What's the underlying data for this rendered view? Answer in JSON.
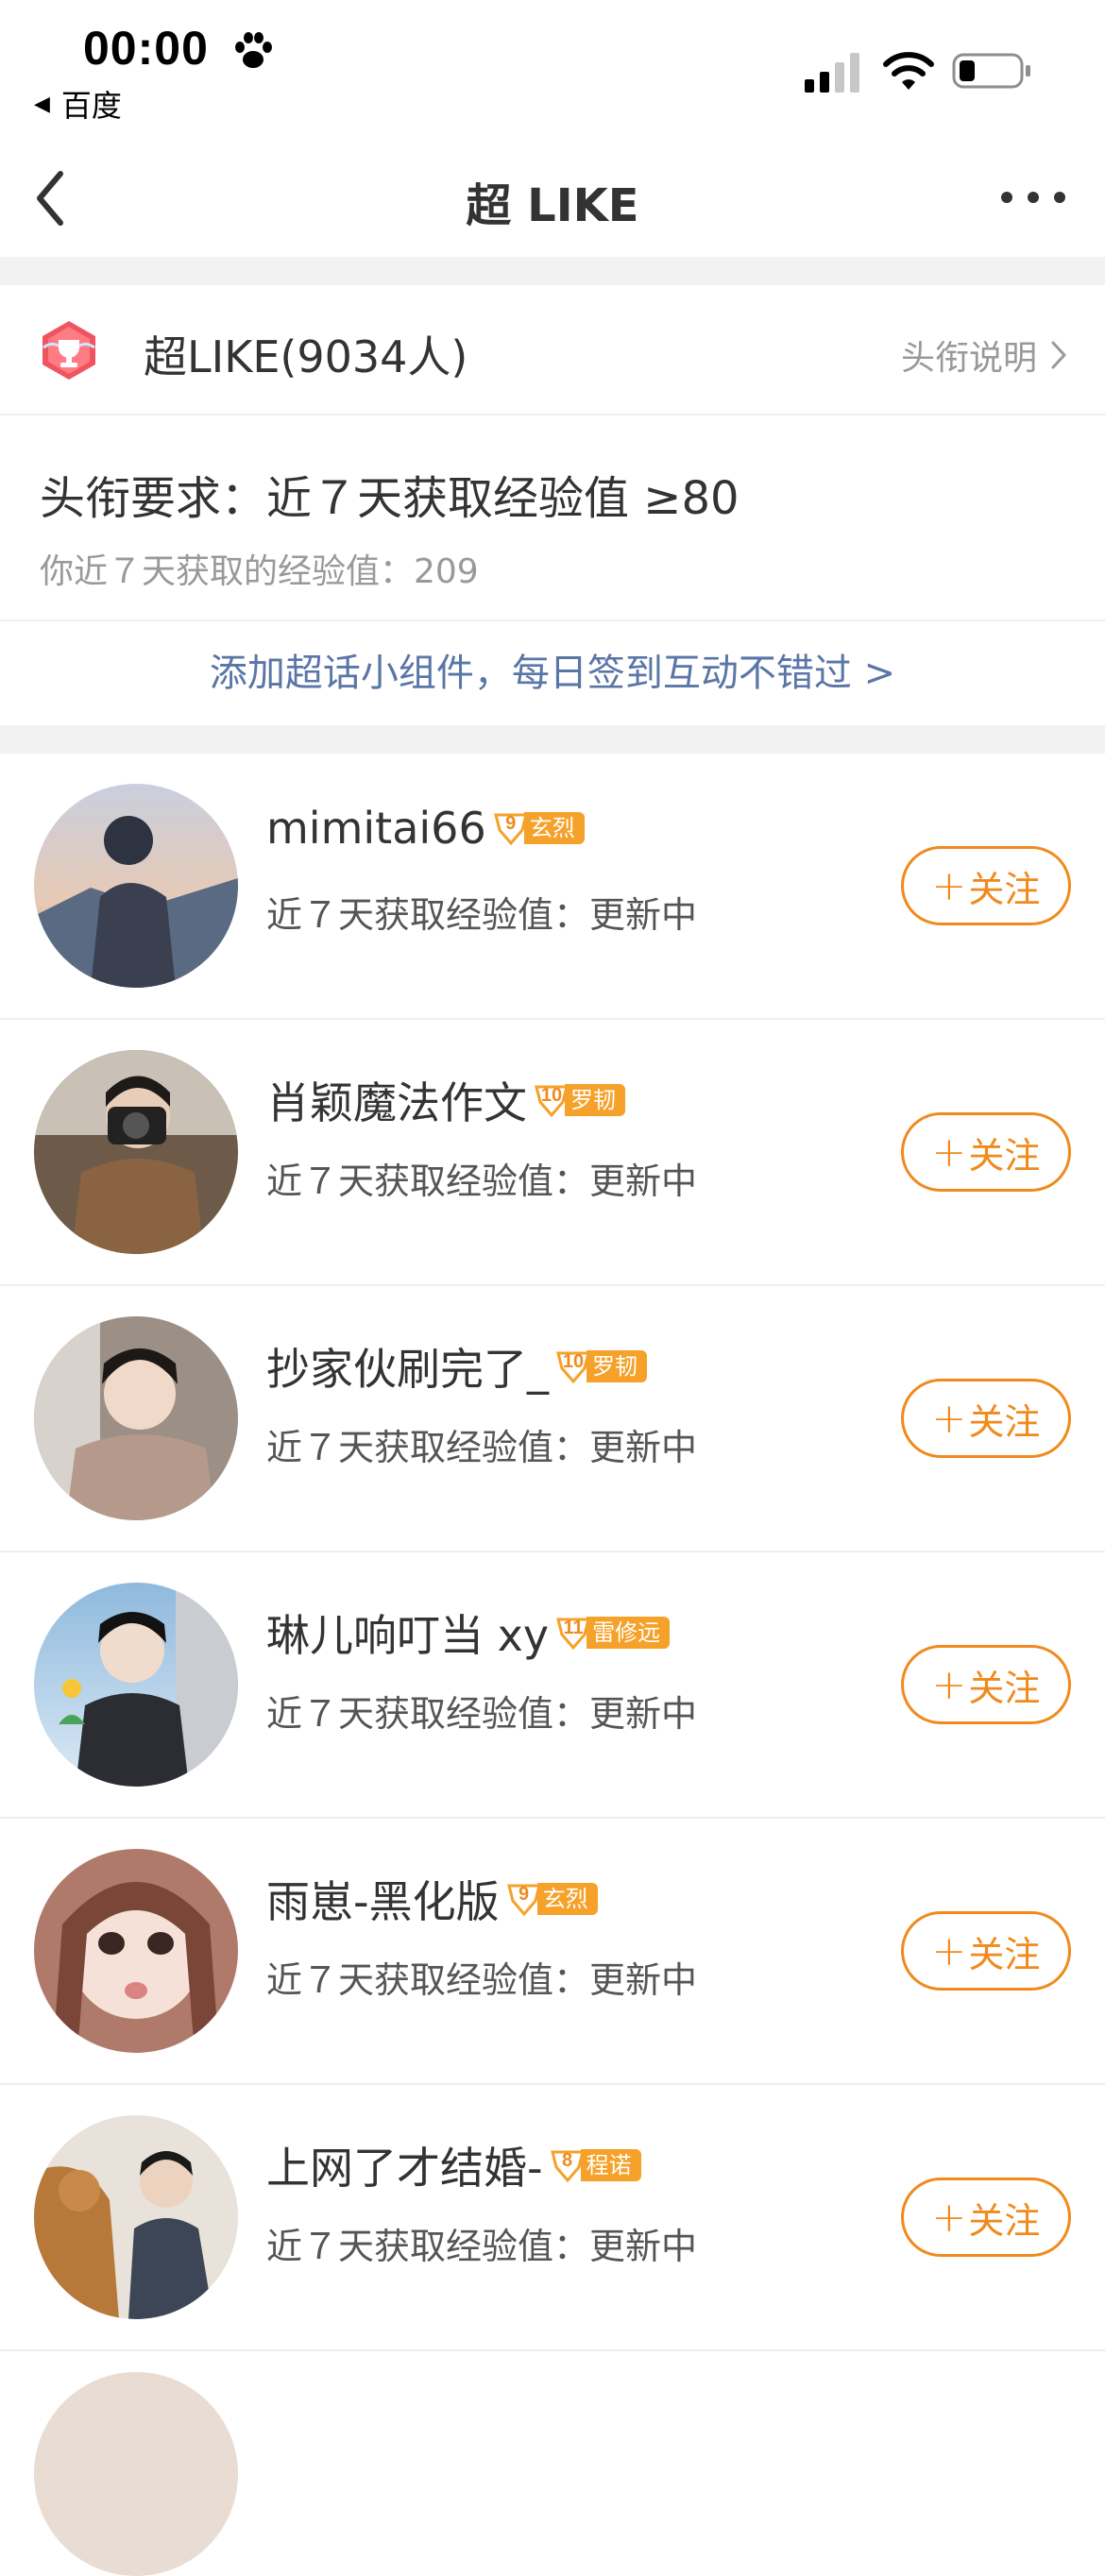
{
  "status_bar": {
    "time": "00:00",
    "back_app": "百度",
    "back_arrow": "◀",
    "icons": [
      "paw-icon",
      "signal-icon",
      "wifi-icon",
      "battery-icon"
    ]
  },
  "nav": {
    "title": "超 LIKE",
    "back_icon": "chevron-left-icon",
    "more_icon": "more-dots-icon"
  },
  "title_card": {
    "title": "超LIKE(9034人)",
    "link": "头衔说明",
    "requirement": "头衔要求：近７天获取经验值 ≥80",
    "my_exp": "你近７天获取的经验值：209",
    "widget_link": "添加超话小组件，每日签到互动不错过 >"
  },
  "users": [
    {
      "name": "mimitai66",
      "level": "9",
      "rank": "玄烈",
      "exp": "近７天获取经验值：更新中",
      "follow": "关注"
    },
    {
      "name": "肖颖魔法作文",
      "level": "10",
      "rank": "罗韧",
      "exp": "近７天获取经验值：更新中",
      "follow": "关注"
    },
    {
      "name": "抄家伙刷完了_",
      "level": "10",
      "rank": "罗韧",
      "exp": "近７天获取经验值：更新中",
      "follow": "关注"
    },
    {
      "name": "琳儿响叮当 xy",
      "level": "11",
      "rank": "雷修远",
      "exp": "近７天获取经验值：更新中",
      "follow": "关注"
    },
    {
      "name": "雨崽-黑化版",
      "level": "9",
      "rank": "玄烈",
      "exp": "近７天获取经验值：更新中",
      "follow": "关注"
    },
    {
      "name": "上网了才结婚-",
      "level": "8",
      "rank": "程诺",
      "exp": "近７天获取经验值：更新中",
      "follow": "关注"
    }
  ],
  "colors": {
    "accent": "#f08a1d",
    "badge": "#f5a12a",
    "link": "#5a76a7",
    "muted": "#999999"
  }
}
